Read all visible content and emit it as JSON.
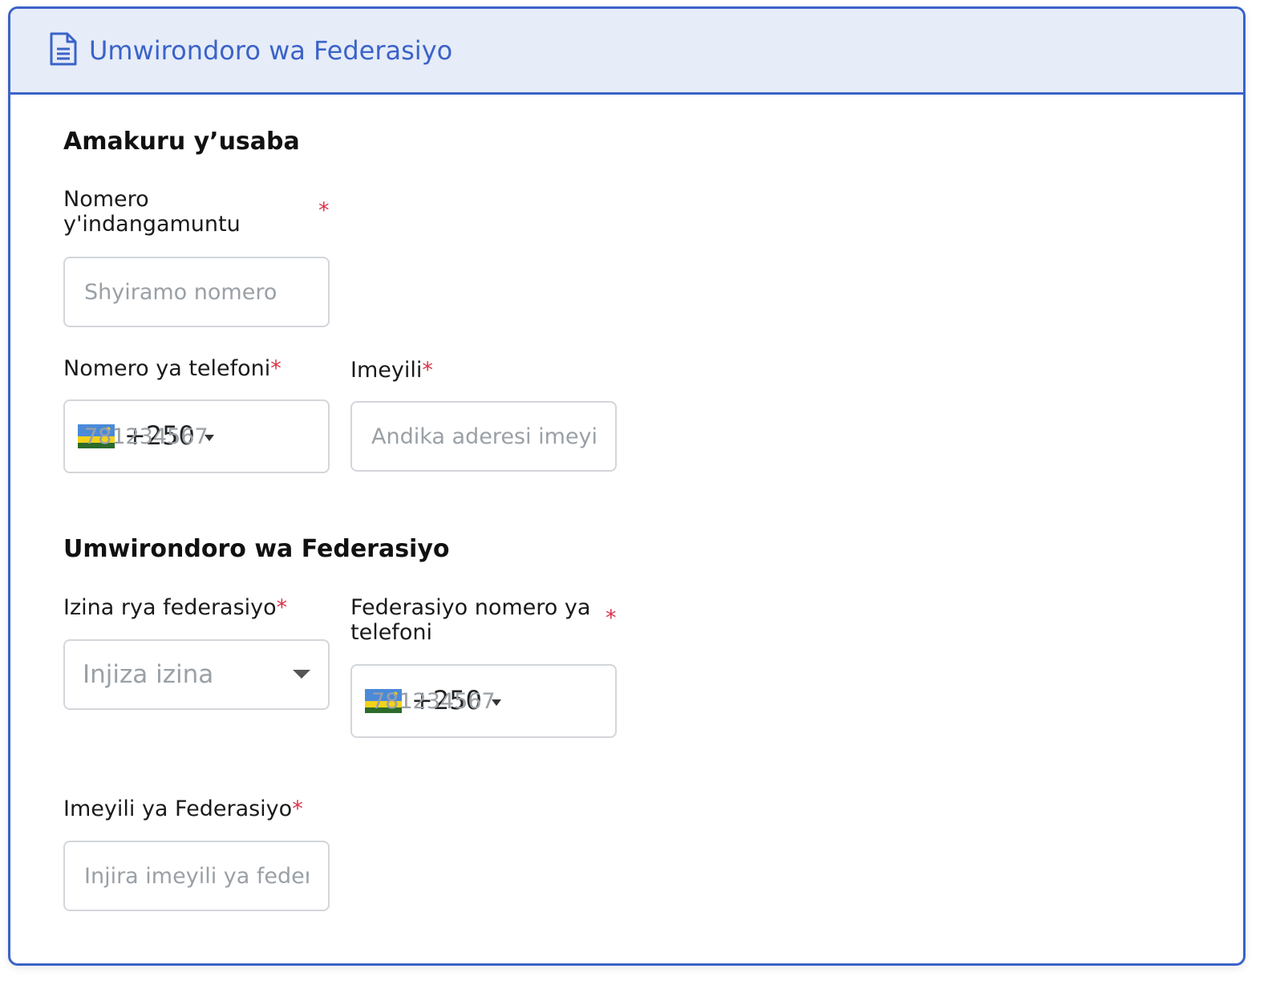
{
  "panel": {
    "title": "Umwirondoro wa Federasiyo",
    "icon": "document-icon",
    "accent_color": "#3b63c8",
    "header_bg": "#e6ecf8"
  },
  "applicant_section": {
    "title": "Amakuru y’usaba",
    "id_number": {
      "label": "Nomero y'indangamuntu",
      "required_mark": "*",
      "placeholder": "Shyiramo nomero"
    },
    "phone": {
      "label": "Nomero ya telefoni",
      "required_mark": "*",
      "country_code": "+250",
      "flag": "rwanda-flag-icon",
      "placeholder": "781234567"
    },
    "email": {
      "label": "Imeyili",
      "required_mark": "*",
      "placeholder": "Andika aderesi imeyili"
    }
  },
  "federation_section": {
    "title": "Umwirondoro wa Federasiyo",
    "name": {
      "label": "Izina rya federasiyo",
      "required_mark": "*",
      "placeholder": "Injiza izina"
    },
    "phone": {
      "label": "Federasiyo nomero ya telefoni",
      "required_mark": "*",
      "country_code": "+250",
      "flag": "rwanda-flag-icon",
      "placeholder": "781234567"
    },
    "email": {
      "label": "Imeyili ya Federasiyo",
      "required_mark": "*",
      "placeholder": "Injira imeyili ya federasiyo"
    }
  },
  "colors": {
    "required": "#d9334a",
    "border": "#d3d6da",
    "placeholder": "#9aa0a6"
  }
}
